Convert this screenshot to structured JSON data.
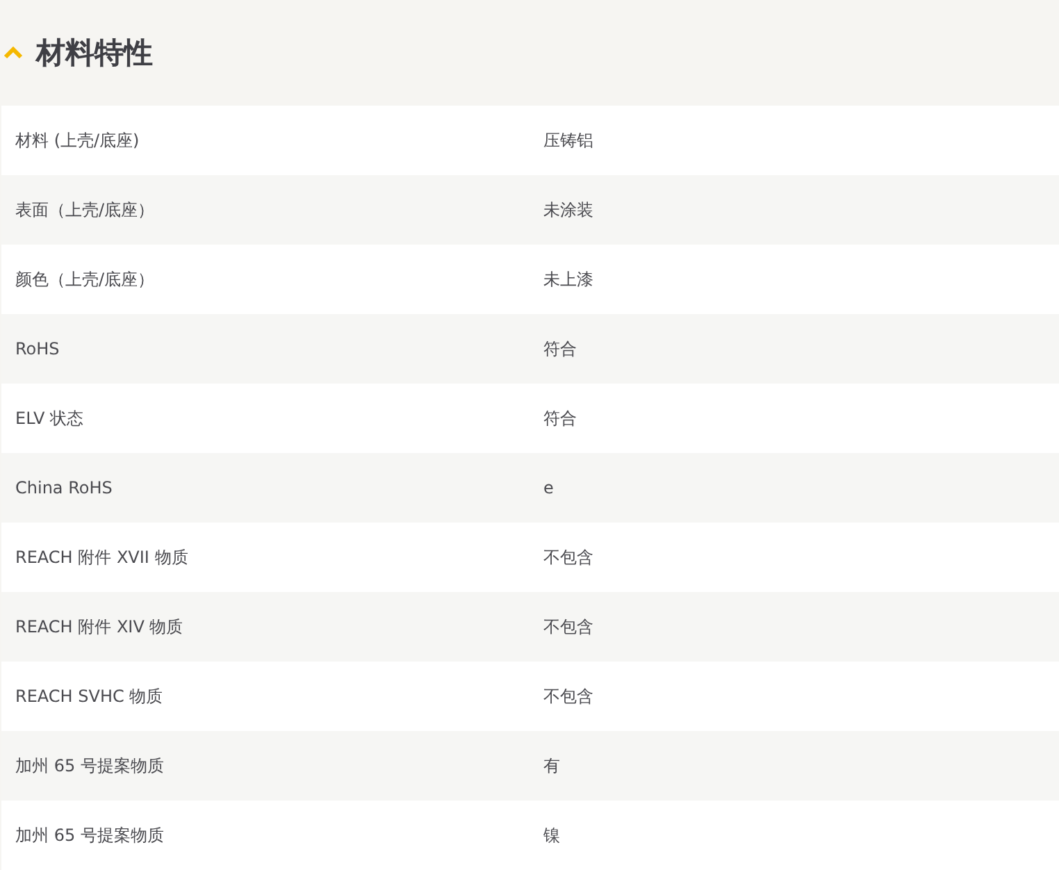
{
  "section": {
    "title": "材料特性",
    "expanded": true
  },
  "rows": [
    {
      "label": "材料 (上壳/底座)",
      "value": "压铸铝"
    },
    {
      "label": "表面（上壳/底座）",
      "value": "未涂装"
    },
    {
      "label": "颜色（上壳/底座）",
      "value": "未上漆"
    },
    {
      "label": "RoHS",
      "value": "符合"
    },
    {
      "label": "ELV 状态",
      "value": "符合"
    },
    {
      "label": "China RoHS",
      "value": "e"
    },
    {
      "label": "REACH 附件 XVII 物质",
      "value": "不包含"
    },
    {
      "label": "REACH 附件 XIV 物质",
      "value": "不包含"
    },
    {
      "label": "REACH SVHC 物质",
      "value": "不包含"
    },
    {
      "label": "加州 65 号提案物质",
      "value": "有"
    },
    {
      "label": "加州 65 号提案物质",
      "value": "镍"
    }
  ]
}
